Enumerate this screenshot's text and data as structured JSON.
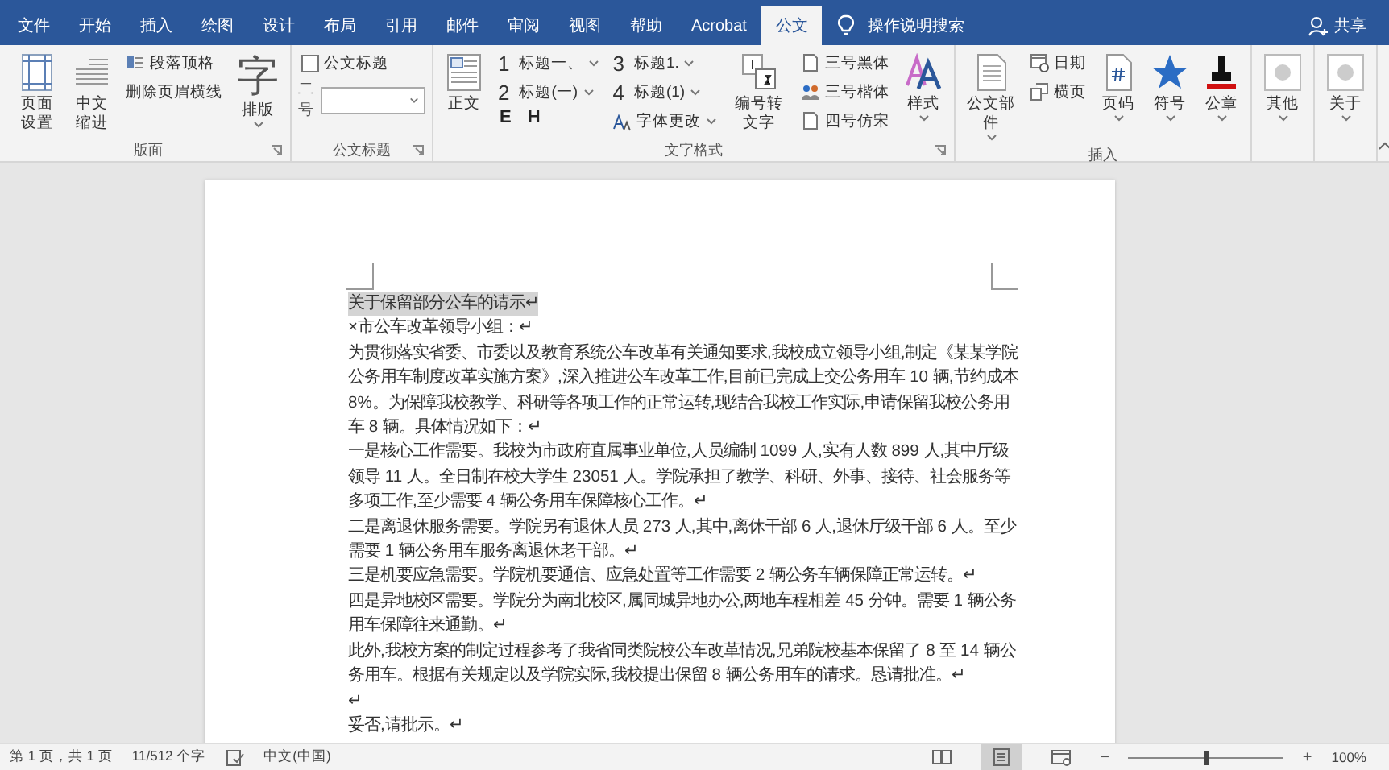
{
  "tabs": [
    {
      "label": "文件",
      "selected": false
    },
    {
      "label": "开始",
      "selected": false
    },
    {
      "label": "插入",
      "selected": false
    },
    {
      "label": "绘图",
      "selected": false
    },
    {
      "label": "设计",
      "selected": false
    },
    {
      "label": "布局",
      "selected": false
    },
    {
      "label": "引用",
      "selected": false
    },
    {
      "label": "邮件",
      "selected": false
    },
    {
      "label": "审阅",
      "selected": false
    },
    {
      "label": "视图",
      "selected": false
    },
    {
      "label": "帮助",
      "selected": false
    },
    {
      "label": "Acrobat",
      "selected": false
    },
    {
      "label": "公文",
      "selected": true
    }
  ],
  "tell_me": {
    "placeholder": "操作说明搜索"
  },
  "share": {
    "label": "共享"
  },
  "ribbon": {
    "groups": [
      {
        "label": "版面",
        "launcher": true,
        "items": [
          {
            "kind": "large",
            "label": "页面设置"
          },
          {
            "kind": "large",
            "label": "中文缩进"
          },
          {
            "kind": "stack",
            "rows": [
              {
                "label": "段落顶格"
              },
              {
                "label": "删除页眉横线"
              }
            ]
          },
          {
            "kind": "glyph",
            "glyph": "字",
            "label": "排版",
            "dropdown": true
          }
        ]
      },
      {
        "label": "公文标题",
        "launcher": true,
        "items": [
          {
            "kind": "title",
            "check": {
              "label": "公文标题",
              "checked": false
            },
            "combo": {
              "label": "二号"
            }
          }
        ]
      },
      {
        "label": "文字格式",
        "launcher": true,
        "items": [
          {
            "kind": "large",
            "label": "正文"
          },
          {
            "kind": "gallery",
            "rows": [
              {
                "number": "1",
                "label": "标题一、"
              },
              {
                "number": "2",
                "label": "标题(一)"
              }
            ],
            "letters": [
              "E",
              "H"
            ]
          },
          {
            "kind": "gallery",
            "rows": [
              {
                "number": "3",
                "label": "标题1."
              },
              {
                "number": "4",
                "label": "标题(1)"
              }
            ],
            "extra": {
              "label": "字体更改"
            }
          },
          {
            "kind": "large",
            "label": "编号转文字"
          },
          {
            "kind": "stack",
            "rows": [
              {
                "label": "三号黑体"
              },
              {
                "label": "三号楷体"
              },
              {
                "label": "四号仿宋"
              }
            ]
          },
          {
            "kind": "large",
            "label": "样式",
            "dropdown": true
          }
        ]
      },
      {
        "label": "插入",
        "launcher": false,
        "items": [
          {
            "kind": "large",
            "label": "公文部件",
            "dropdown": true
          },
          {
            "kind": "stack",
            "rows": [
              {
                "label": "日期"
              },
              {
                "label": "横页"
              }
            ]
          },
          {
            "kind": "large",
            "label": "页码",
            "dropdown": true
          },
          {
            "kind": "large",
            "label": "符号",
            "dropdown": true
          },
          {
            "kind": "large",
            "label": "公章",
            "dropdown": true
          }
        ]
      },
      {
        "launcher": false,
        "items": [
          {
            "kind": "large",
            "label": "其他",
            "dropdown": true
          }
        ]
      },
      {
        "launcher": false,
        "items": [
          {
            "kind": "large",
            "label": "关于",
            "dropdown": true
          }
        ]
      }
    ]
  },
  "document": {
    "paragraphs": [
      {
        "text": "关于保留部分公车的请示↵",
        "selected": true
      },
      {
        "text": "×市公车改革领导小组：↵",
        "selected": false
      },
      {
        "text": "为贯彻落实省委、市委以及教育系统公车改革有关通知要求,我校成立领导小组,制定《某某学院公务用车制度改革实施方案》,深入推进公车改革工作,目前已完成上交公务用车 10 辆,节约成本 8%。为保障我校教学、科研等各项工作的正常运转,现结合我校工作实际,申请保留我校公务用车 8 辆。具体情况如下：↵",
        "selected": false
      },
      {
        "text": "一是核心工作需要。我校为市政府直属事业单位,人员编制 1099 人,实有人数 899 人,其中厅级领导 11 人。全日制在校大学生 23051 人。学院承担了教学、科研、外事、接待、社会服务等多项工作,至少需要 4 辆公务用车保障核心工作。↵",
        "selected": false
      },
      {
        "text": "二是离退休服务需要。学院另有退休人员 273 人,其中,离休干部 6 人,退休厅级干部 6 人。至少需要 1 辆公务用车服务离退休老干部。↵",
        "selected": false
      },
      {
        "text": "三是机要应急需要。学院机要通信、应急处置等工作需要 2 辆公务车辆保障正常运转。↵",
        "selected": false
      },
      {
        "text": "四是异地校区需要。学院分为南北校区,属同城异地办公,两地车程相差 45 分钟。需要 1 辆公务用车保障往来通勤。↵",
        "selected": false
      },
      {
        "text": "此外,我校方案的制定过程参考了我省同类院校公车改革情况,兄弟院校基本保留了 8 至 14 辆公务用车。根据有关规定以及学院实际,我校提出保留 8 辆公务用车的请求。恳请批准。↵",
        "selected": false
      },
      {
        "text": "↵",
        "selected": false
      },
      {
        "text": "妥否,请批示。↵",
        "selected": false
      }
    ]
  },
  "status_bar": {
    "page": "第 1 页，共 1 页",
    "words": "11/512 个字",
    "language": "中文(中国)",
    "views": [
      {
        "selected": false
      },
      {
        "selected": true
      },
      {
        "selected": false
      }
    ],
    "zoom": {
      "minus": "−",
      "plus": "+",
      "level": 0.5,
      "reading": "100%"
    }
  }
}
